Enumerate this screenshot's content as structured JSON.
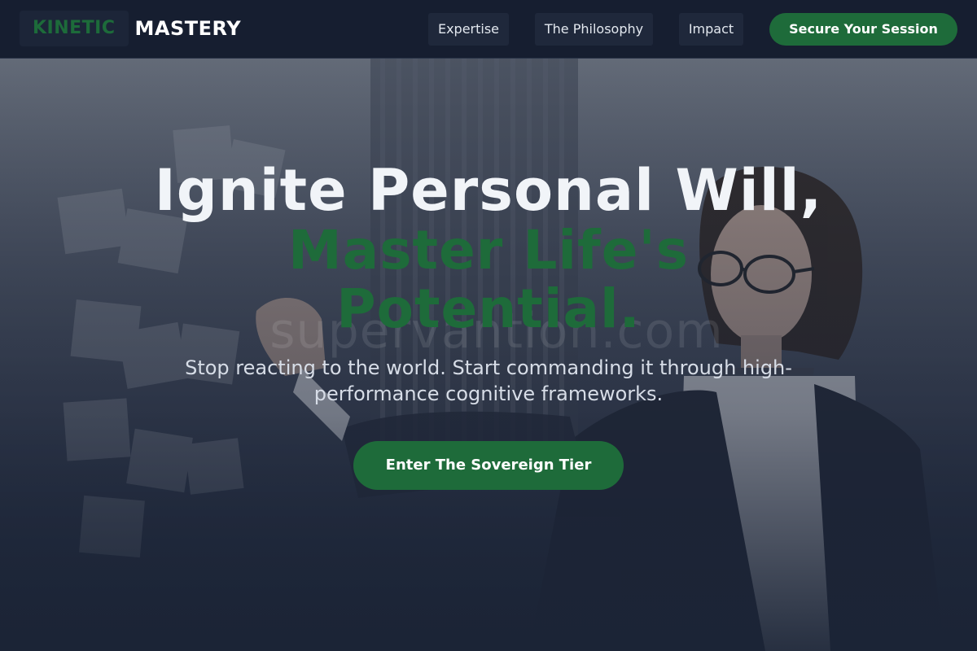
{
  "nav": {
    "logo_mark": "KINETIC",
    "logo_word": "MASTERY",
    "links": [
      {
        "label": "Expertise"
      },
      {
        "label": "The Philosophy"
      },
      {
        "label": "Impact"
      }
    ],
    "cta_label": "Secure Your Session"
  },
  "hero": {
    "headline_line1": "Ignite Personal Will,",
    "headline_line2": "Master Life's Potential.",
    "subheadline": "Stop reacting to the world. Start commanding it through high-performance cognitive frameworks.",
    "cta_label": "Enter The Sovereign Tier",
    "watermark_text": "supervantion.com"
  },
  "colors": {
    "accent_green": "#1e6b3a",
    "nav_background": "#161e30",
    "hero_dark": "#1b2436"
  }
}
